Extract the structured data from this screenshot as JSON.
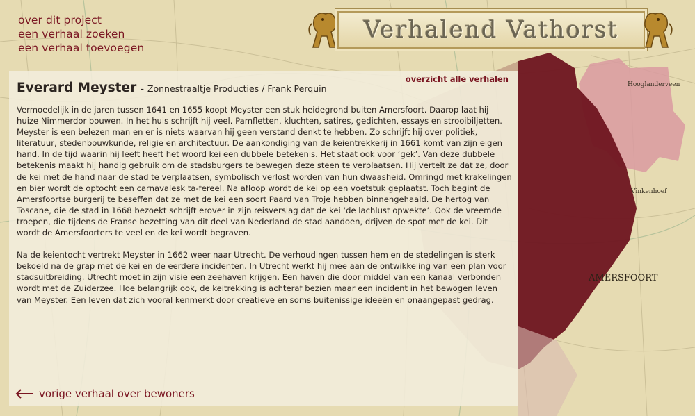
{
  "nav": {
    "items": [
      "over dit project",
      "een verhaal zoeken",
      "een verhaal toevoegen"
    ]
  },
  "logo": {
    "title": "Verhalend Vathorst"
  },
  "story": {
    "overview_link": "overzicht alle verhalen",
    "title": "Everard Meyster",
    "separator": "-",
    "author": "Zonnestraaltje Producties / Frank Perquin",
    "paragraphs": [
      "Vermoedelijk in de jaren tussen 1641 en 1655 koopt Meyster een stuk heidegrond buiten Amersfoort. Daarop laat hij huize Nimmerdor bouwen. In het huis schrijft hij veel. Pamfletten, kluchten, satires, gedichten, essays en strooibiljetten. Meyster is een belezen man en er is niets waarvan hij geen verstand denkt te hebben. Zo schrijft hij over politiek, literatuur, stedenbouwkunde, religie en architectuur. De aankondiging van de keientrekkerij in 1661 komt van zijn eigen hand. In de tijd waarin hij leeft heeft het woord kei een dubbele betekenis. Het staat ook voor ‘gek’. Van deze dubbele betekenis maakt hij handig gebruik om de stadsburgers te bewegen deze steen te verplaatsen. Hij vertelt ze dat ze, door de kei met de hand naar de stad te verplaatsen, symbolisch verlost worden van hun dwaasheid. Omringd met krakelingen en bier wordt de optocht een carnavalesk ta-fereel. Na afloop wordt de kei op een voetstuk geplaatst. Toch begint de Amersfoortse burgerij te beseffen dat ze met de kei een soort Paard van Troje hebben binnengehaald. De hertog van Toscane, die de stad in 1668 bezoekt schrijft erover in zijn reisverslag dat de kei ‘de lachlust opwekte’. Ook de vreemde troepen, die tijdens de Franse bezetting van dit deel van Nederland de stad aandoen, drijven de spot met de kei. Dit wordt de Amersfoorters te veel en de kei wordt begraven.",
      "Na de keientocht vertrekt Meyster in 1662 weer naar Utrecht. De verhoudingen tussen hem en de stedelingen is sterk bekoeld na de grap met de kei en de eerdere incidenten. In Utrecht werkt hij mee aan de ontwikkeling van een plan voor stadsuitbreiding. Utrecht moet in zijn visie een zeehaven krijgen. Een haven die door middel van een kanaal verbonden wordt met de Zuiderzee. Hoe belangrijk ook, de keitrekking is achteraf bezien maar een incident in het bewogen leven van Meyster. Een leven dat zich vooral kenmerkt door creatieve en soms buitenissige ideeën en onaangepast gedrag."
    ],
    "prev_link": "vorige verhaal over bewoners"
  },
  "map_labels": {
    "hooglanderveen": "Hooglanderveen",
    "vinkenhoef": "Vinkenhoef",
    "amersfoort": "AMERSFOORT"
  },
  "colors": {
    "accent": "#7a1622",
    "region_dark": "#6e1520",
    "region_light": "#d99aa0",
    "paper": "#e9dfb8"
  }
}
